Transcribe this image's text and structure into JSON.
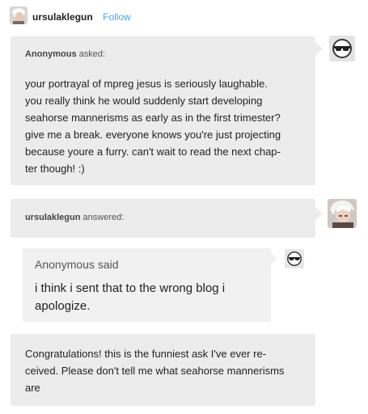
{
  "post": {
    "blog_name": "ursulaklegun",
    "follow_label": "Follow"
  },
  "ask": {
    "asker": "Anonymous",
    "verb": "asked:",
    "lines": [
      "your portrayal of mpreg jesus is seriously laughable.",
      "you really think he would suddenly start developing",
      "seahorse mannerisms as early as in the first trimester?",
      "give me a break. everyone knows you're just projecting",
      "because youre a furry. can't wait to read the next chap-",
      "ter though! :)"
    ]
  },
  "answer": {
    "answerer": "ursulaklegun",
    "verb": "answered:",
    "quoted": {
      "name": "Anonymous",
      "said": "said",
      "lines": [
        "i think i sent that to the wrong blog i",
        "apologize."
      ]
    },
    "reply_lines": [
      "Congratulations! this is the funniest ask I've ever re-",
      "ceived. Please don't tell me what seahorse mannerisms",
      "are"
    ]
  },
  "colors": {
    "follow": "#4aa0e8",
    "bubble": "#ececec"
  }
}
